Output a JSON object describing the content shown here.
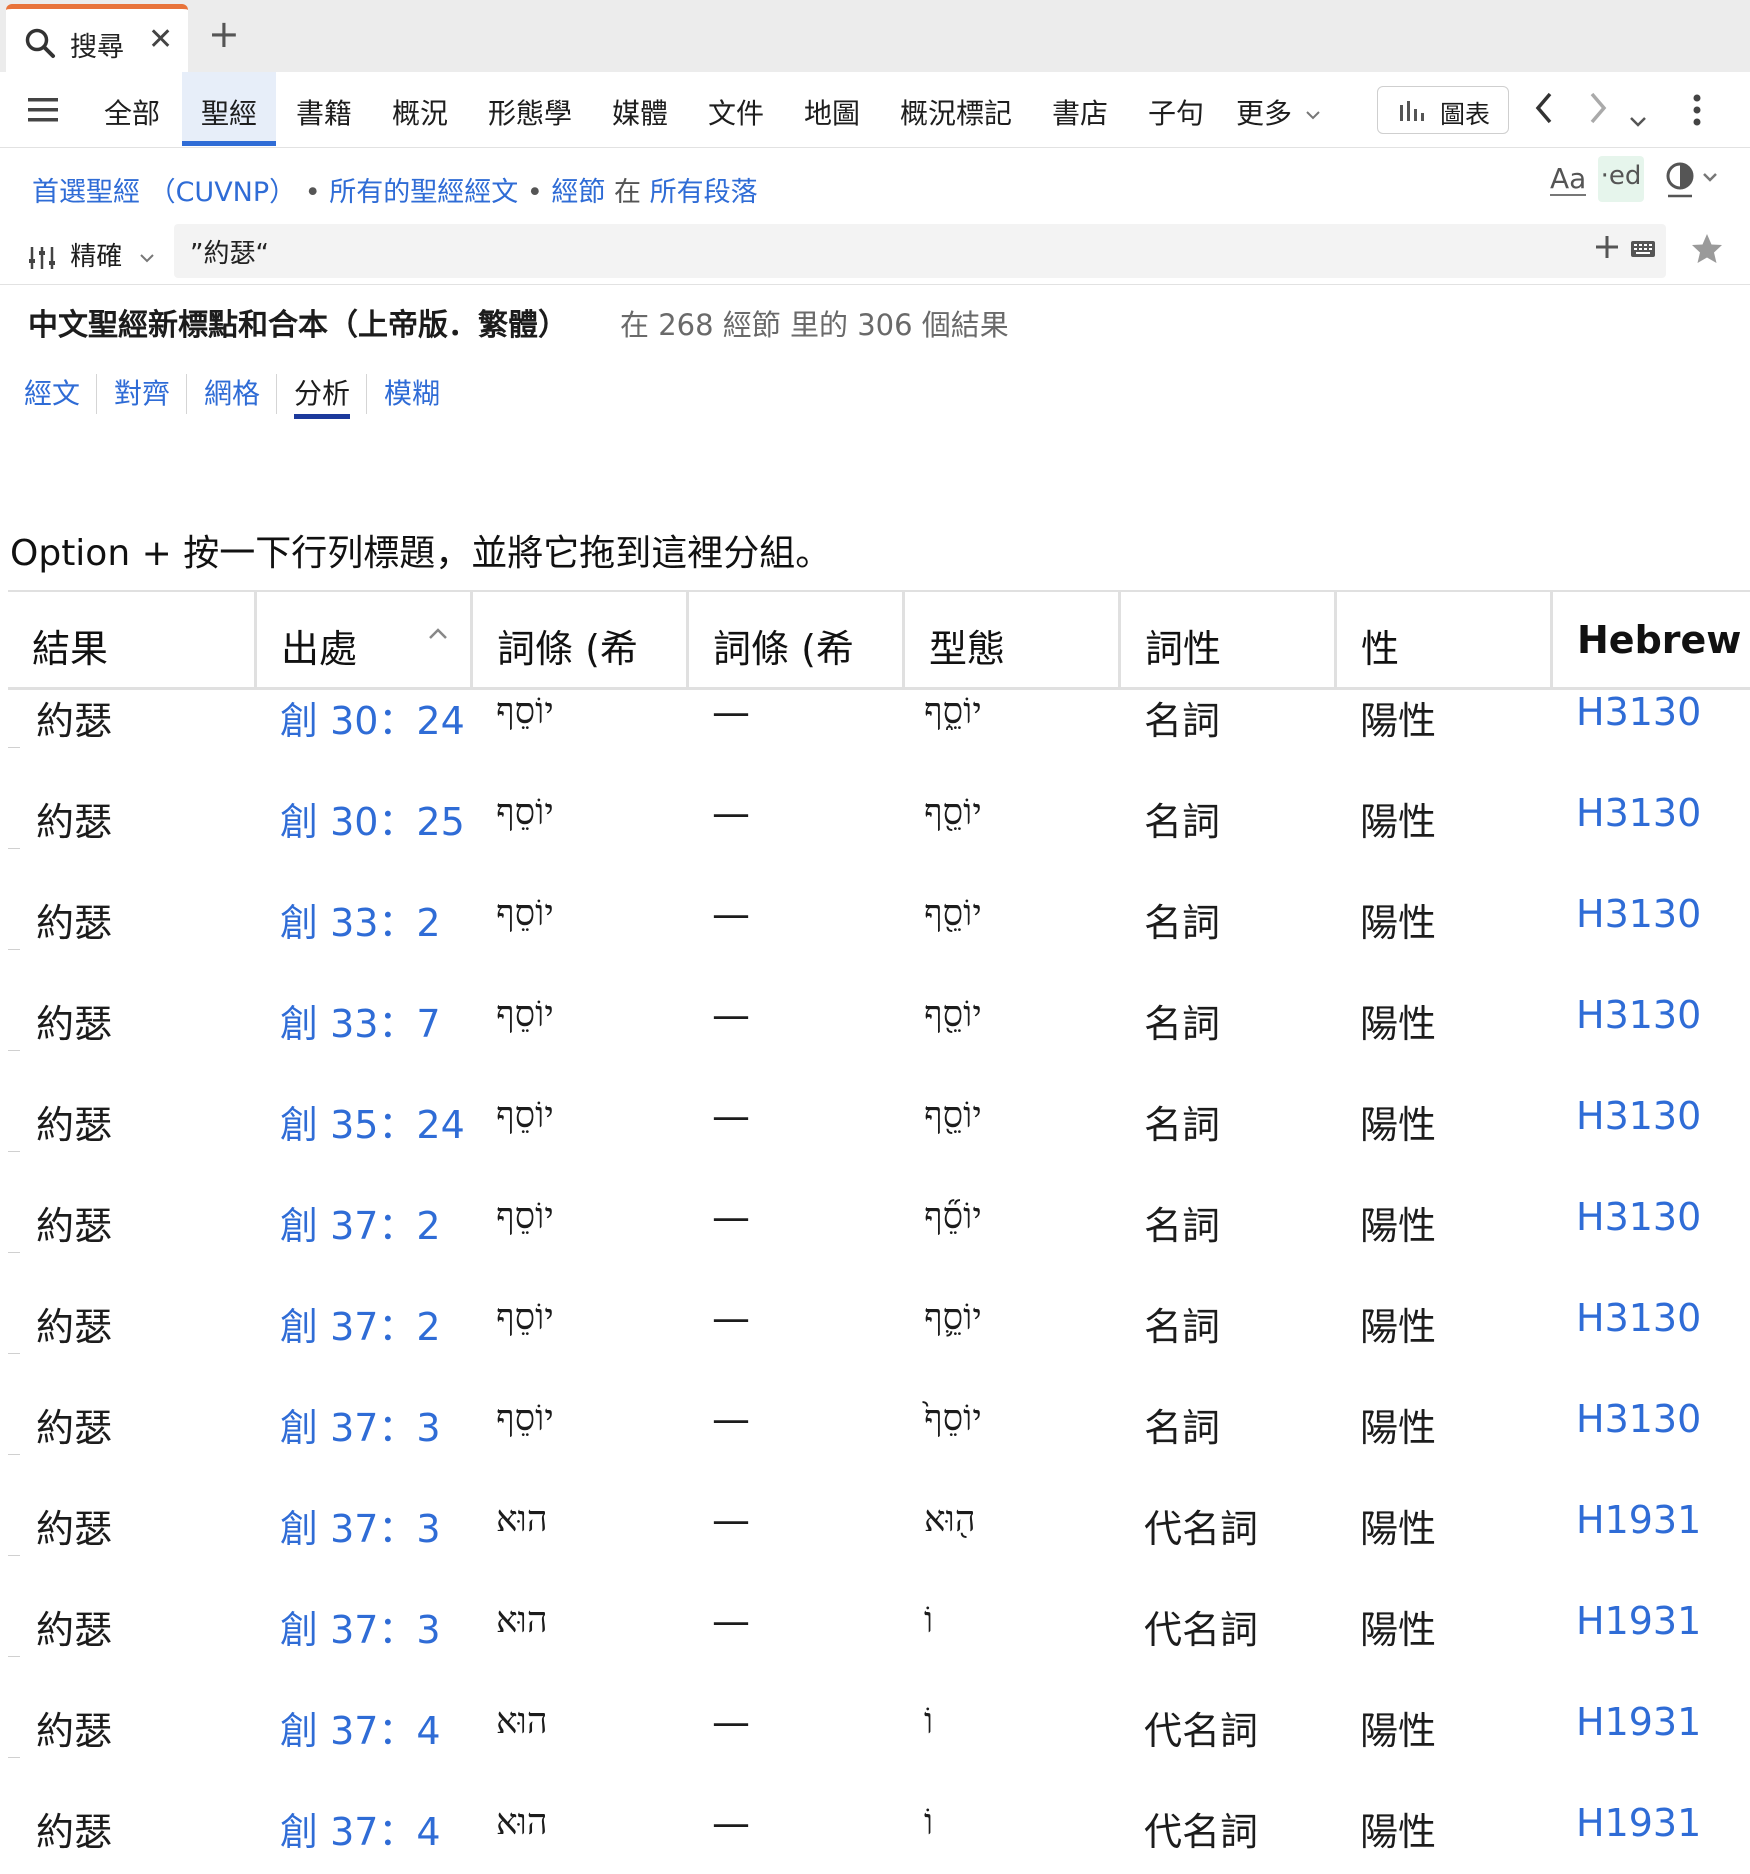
{
  "tab": {
    "label": "搜尋",
    "close": "✕",
    "new_tab": "+"
  },
  "nav": {
    "items": [
      "全部",
      "聖經",
      "書籍",
      "概況",
      "形態學",
      "媒體",
      "文件",
      "地圖",
      "概況標記",
      "書店",
      "子句"
    ],
    "active": "聖經",
    "more": "更多",
    "chart_button": "圖表"
  },
  "context": {
    "bible": "首選聖經 （CUVNP）",
    "sep1": "•",
    "scope": "所有的聖經經文",
    "sep2": "•",
    "unit": "經節",
    "in": "在",
    "range": "所有段落"
  },
  "tools": {
    "font": "Aa",
    "ed": "·ed"
  },
  "search": {
    "mode": "精確",
    "query": "”約瑟“"
  },
  "results": {
    "title": "中文聖經新標點和合本（上帝版．繁體）",
    "count": "在 268 經節 里的 306 個結果"
  },
  "view_tabs": [
    "經文",
    "對齊",
    "網格",
    "分析",
    "模糊"
  ],
  "active_view": "分析",
  "group_hint": "Option + 按一下行列標題，並將它拖到這裡分組。",
  "table": {
    "headers": [
      "結果",
      "出處",
      "詞條 (希",
      "詞條 (希",
      "型態",
      "詞性",
      "性",
      "Hebrew"
    ],
    "rows": [
      [
        "約瑟",
        "創 30：24",
        "יוֹסֵף",
        "—",
        "יוֹסֵ֑ף",
        "名詞",
        "陽性",
        "H3130"
      ],
      [
        "約瑟",
        "創 30：25",
        "יוֹסֵף",
        "—",
        "יוֹסֵ֖ף",
        "名詞",
        "陽性",
        "H3130"
      ],
      [
        "約瑟",
        "創 33：2",
        "יוֹסֵף",
        "—",
        "יוֹסֵ֖ף",
        "名詞",
        "陽性",
        "H3130"
      ],
      [
        "約瑟",
        "創 33：7",
        "יוֹסֵף",
        "—",
        "יוֹסֵ֖ף",
        "名詞",
        "陽性",
        "H3130"
      ],
      [
        "約瑟",
        "創 35：24",
        "יוֹסֵף",
        "—",
        "יוֹסֵ֖ף",
        "名詞",
        "陽性",
        "H3130"
      ],
      [
        "約瑟",
        "創 37：2",
        "יוֹסֵף",
        "—",
        "יוֹסֵ֞ף",
        "名詞",
        "陽性",
        "H3130"
      ],
      [
        "約瑟",
        "創 37：2",
        "יוֹסֵף",
        "—",
        "יוֹסֵ֛ף",
        "名詞",
        "陽性",
        "H3130"
      ],
      [
        "約瑟",
        "創 37：3",
        "יוֹסֵף",
        "—",
        "יוֹסֵף֙",
        "名詞",
        "陽性",
        "H3130"
      ],
      [
        "約瑟",
        "創 37：3",
        "הוּא",
        "—",
        "ה֖וּא",
        "代名詞",
        "陽性",
        "H1931"
      ],
      [
        "約瑟",
        "創 37：3",
        "הוּא",
        "—",
        "וֹ",
        "代名詞",
        "陽性",
        "H1931"
      ],
      [
        "約瑟",
        "創 37：4",
        "הוּא",
        "—",
        "וֹ",
        "代名詞",
        "陽性",
        "H1931"
      ],
      [
        "約瑟",
        "創 37：4",
        "הוּא",
        "—",
        "וֹ",
        "代名詞",
        "陽性",
        "H1931"
      ]
    ]
  },
  "colors": {
    "accent": "#2f6cd6",
    "tab_top": "#e8733a",
    "underline": "#1c3a9c"
  }
}
